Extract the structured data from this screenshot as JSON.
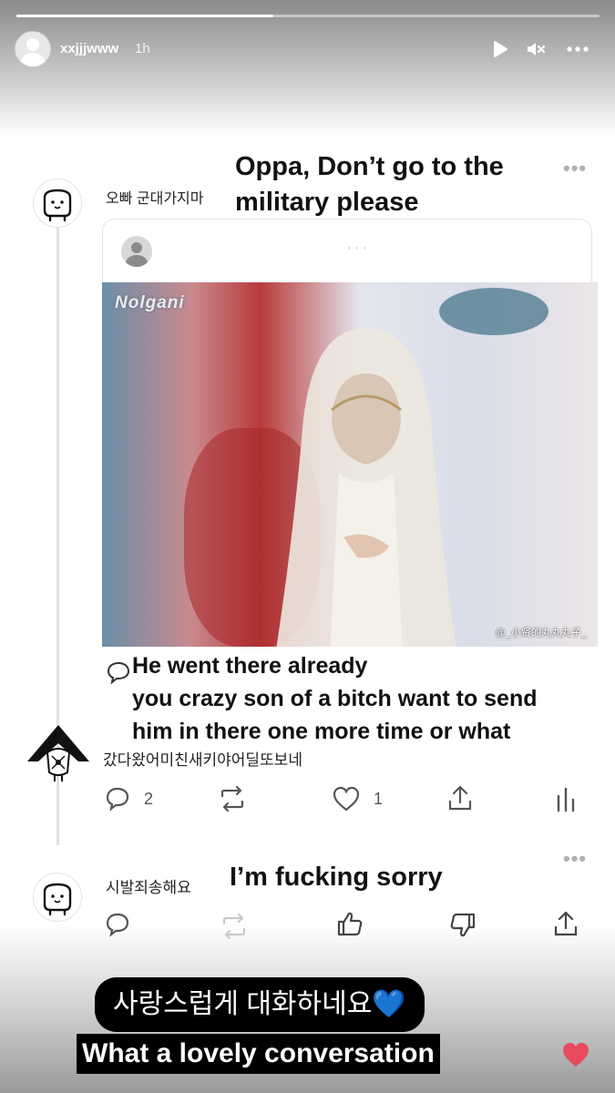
{
  "story": {
    "username": "xxjjjwww",
    "timestamp": "1h",
    "progress": 0.44
  },
  "post1": {
    "korean_text": "오빠 군대가지마",
    "english_overlay": [
      "Oppa, Don’t go to the",
      "military please"
    ],
    "more_icon": "•••"
  },
  "quote": {
    "placeholder_dots": "· · ·",
    "photo_watermark_top": "Nolgani",
    "photo_watermark_bottom": "@_小贤的丸丸丸子_"
  },
  "reply1": {
    "english_overlay": [
      "He went there already",
      "you crazy son of a bitch want to send",
      "him in there one more time or what"
    ],
    "korean_text": "갔다왔어미친새키야어딜또보네",
    "actions": {
      "reply_count": "2",
      "like_count": "1"
    }
  },
  "reply2": {
    "korean_text": "시발죄송해요",
    "english_overlay": "I’m fucking sorry",
    "more_icon": "•••"
  },
  "captions": {
    "korean": "사랑스럽게 대화하네요",
    "korean_emoji": "💙",
    "english": "What a lovely conversation"
  },
  "colors": {
    "heart": "#e84a5f",
    "caption_bg": "#000000"
  },
  "icons": [
    "play-icon",
    "mute-icon",
    "more-icon",
    "reply-icon",
    "repost-icon",
    "heart-icon",
    "share-icon",
    "stats-icon",
    "thumbs-up-icon",
    "thumbs-down-icon"
  ]
}
